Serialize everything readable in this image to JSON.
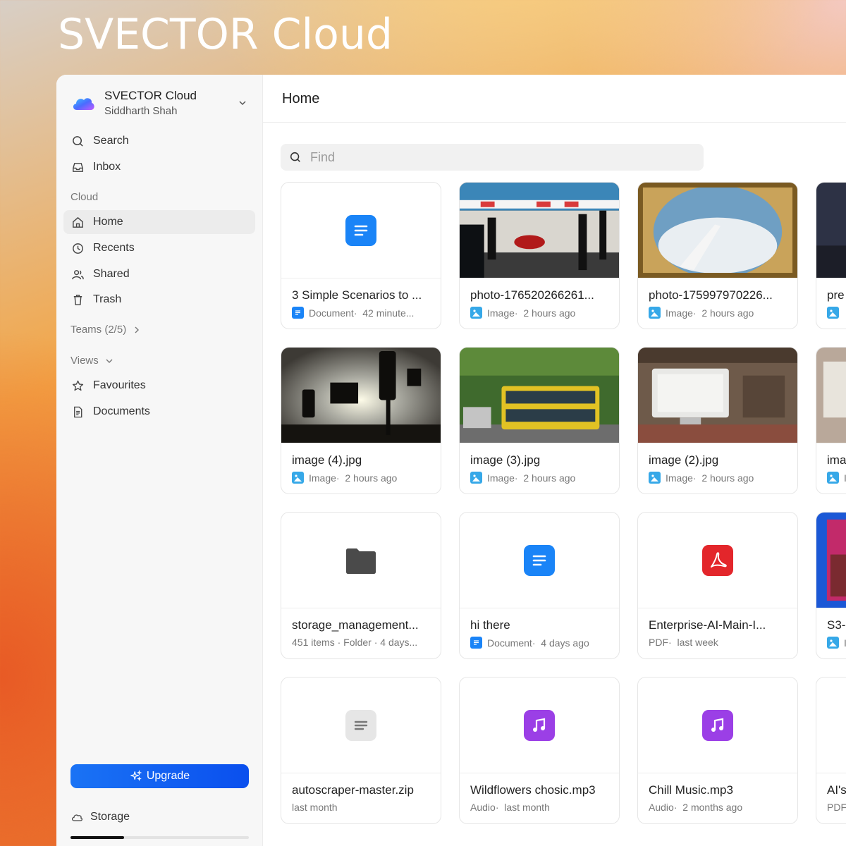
{
  "brand": {
    "title": "SVECTOR Cloud"
  },
  "sidebar": {
    "account_name": "SVECTOR Cloud",
    "account_user": "Siddharth Shah",
    "top_items": [
      {
        "label": "Search",
        "icon": "search-icon"
      },
      {
        "label": "Inbox",
        "icon": "inbox-icon"
      }
    ],
    "cloud_label": "Cloud",
    "cloud_items": [
      {
        "label": "Home",
        "icon": "home-icon",
        "active": true
      },
      {
        "label": "Recents",
        "icon": "clock-icon"
      },
      {
        "label": "Shared",
        "icon": "users-icon"
      },
      {
        "label": "Trash",
        "icon": "trash-icon"
      }
    ],
    "teams_label": "Teams (2/5)",
    "views_label": "Views",
    "views_items": [
      {
        "label": "Favourites",
        "icon": "star-icon"
      },
      {
        "label": "Documents",
        "icon": "document-icon"
      }
    ],
    "upgrade_label": "Upgrade",
    "storage_label": "Storage",
    "storage_used_fraction": 0.3
  },
  "main": {
    "title": "Home",
    "find_placeholder": "Find",
    "files": [
      {
        "name": "3 Simple Scenarios to ...",
        "kind": "Document",
        "meta": "42 minute...",
        "thumb": "document-icon"
      },
      {
        "name": "photo-176520266261...",
        "kind": "Image",
        "meta": "2 hours ago",
        "thumb": "photo-pitlane"
      },
      {
        "name": "photo-175997970226...",
        "kind": "Image",
        "meta": "2 hours ago",
        "thumb": "photo-plane-window"
      },
      {
        "name": "pre",
        "kind": "",
        "meta": "",
        "thumb": "photo-dark",
        "mini": "image"
      },
      {
        "name": "image (4).jpg",
        "kind": "Image",
        "meta": "2 hours ago",
        "thumb": "photo-traffic-light"
      },
      {
        "name": "image (3).jpg",
        "kind": "Image",
        "meta": "2 hours ago",
        "thumb": "photo-bus"
      },
      {
        "name": "image (2).jpg",
        "kind": "Image",
        "meta": "2 hours ago",
        "thumb": "photo-computer"
      },
      {
        "name": "ima",
        "kind": "",
        "meta": "I",
        "thumb": "photo-room",
        "mini": "image"
      },
      {
        "name": "storage_management...",
        "kind": "",
        "meta": "451 items · Folder · 4 days...",
        "thumb": "folder-icon"
      },
      {
        "name": "hi there",
        "kind": "Document",
        "meta": "4 days ago",
        "thumb": "document-icon"
      },
      {
        "name": "Enterprise-AI-Main-I...",
        "kind": "PDF",
        "meta": "last week",
        "thumb": "pdf-icon"
      },
      {
        "name": "S3-",
        "kind": "",
        "meta": "I",
        "thumb": "photo-screen",
        "mini": "image"
      },
      {
        "name": "autoscraper-master.zip",
        "kind": "",
        "meta": "last month",
        "thumb": "archive-icon"
      },
      {
        "name": "Wildflowers chosic.mp3",
        "kind": "Audio",
        "meta": "last month",
        "thumb": "music-icon"
      },
      {
        "name": "Chill Music.mp3",
        "kind": "Audio",
        "meta": "2 months ago",
        "thumb": "music-icon"
      },
      {
        "name": "AI's",
        "kind": "",
        "meta": "PDF",
        "thumb": "blank"
      }
    ]
  },
  "colors": {
    "accent": "#0a6cf5",
    "doc_blue": "#1a84f7",
    "pdf_red": "#e3262b",
    "audio_purple": "#9b3fe6",
    "folder_gray": "#4a4a4a"
  }
}
